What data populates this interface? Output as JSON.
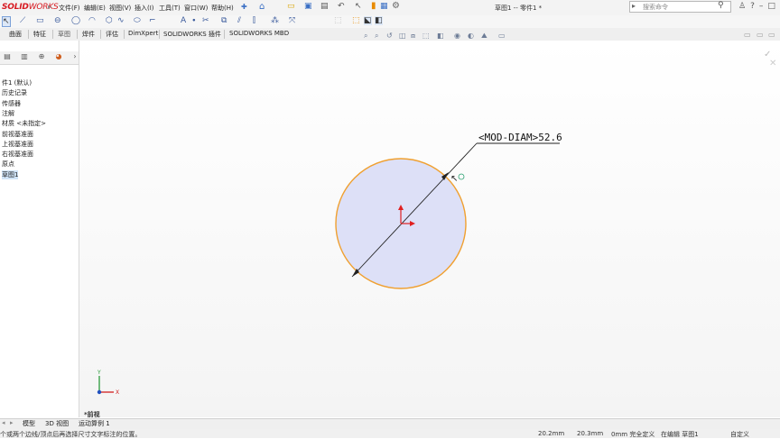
{
  "app": {
    "logo_bold": "SOLID",
    "logo_rest": "WORKS",
    "doc_title": "草图1 -- 零件1 *",
    "search_placeholder": "搜索命令"
  },
  "menu": [
    "文件(F)",
    "编辑(E)",
    "视图(V)",
    "插入(I)",
    "工具(T)",
    "窗口(W)",
    "帮助(H)"
  ],
  "tabs": [
    "曲面",
    "特征",
    "草图",
    "焊件",
    "评估",
    "DimXpert",
    "SOLIDWORKS 插件",
    "SOLIDWORKS MBD"
  ],
  "tree": [
    "件1 (默认)",
    "历史记录",
    "传感器",
    "注解",
    "材质 <未指定>",
    "前视基准面",
    "上视基准面",
    "右视基准面",
    "原点",
    "草图1"
  ],
  "sketch": {
    "dimension_text": "<MOD-DIAM>52.6",
    "view_label": "*前视",
    "axis_y": "Y",
    "axis_x": "X",
    "circle_fill": "#dde0f7",
    "circle_stroke": "#f0a030"
  },
  "bottom_tabs": [
    "模型",
    "3D 视图",
    "运动算例 1"
  ],
  "status": {
    "message": "个或两个边线/顶点后再选择尺寸文字标注的位置。",
    "x": "20.2mm",
    "y": "20.3mm",
    "z_state": "0mm 完全定义",
    "editing": "在编辑 草图1",
    "units": "自定义"
  }
}
